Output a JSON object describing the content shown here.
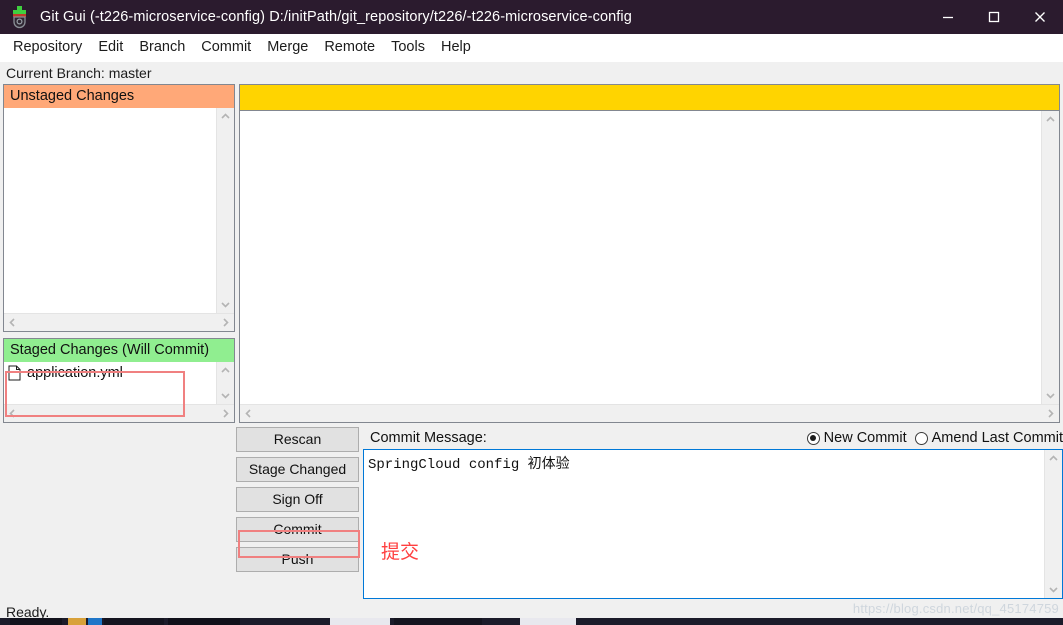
{
  "window": {
    "title": "Git Gui (-t226-microservice-config) D:/initPath/git_repository/t226/-t226-microservice-config",
    "app_icon": "git-gui-icon",
    "controls": {
      "minimize": "minimize-icon",
      "maximize": "maximize-icon",
      "close": "close-icon"
    }
  },
  "menubar": {
    "items": [
      {
        "label": "Repository"
      },
      {
        "label": "Edit"
      },
      {
        "label": "Branch"
      },
      {
        "label": "Commit"
      },
      {
        "label": "Merge"
      },
      {
        "label": "Remote"
      },
      {
        "label": "Tools"
      },
      {
        "label": "Help"
      }
    ]
  },
  "branch": {
    "text": "Current Branch: master"
  },
  "panes": {
    "unstaged": {
      "header": "Unstaged Changes",
      "header_color": "#ffa878",
      "files": []
    },
    "staged": {
      "header": "Staged Changes (Will Commit)",
      "header_color": "#90ee90",
      "files": [
        {
          "name": "application.yml",
          "icon": "file-icon"
        }
      ]
    },
    "diff": {
      "header_strip_color": "#ffd400",
      "content": ""
    }
  },
  "buttons": {
    "rescan": "Rescan",
    "stage_changed": "Stage Changed",
    "sign_off": "Sign Off",
    "commit": "Commit",
    "push": "Push"
  },
  "commit": {
    "label": "Commit Message:",
    "message": "SpringCloud config 初体验",
    "options": [
      {
        "label": "New Commit",
        "selected": true
      },
      {
        "label": "Amend Last Commit",
        "selected": false
      }
    ],
    "new_commit_label": "New Commit",
    "amend_label": "Amend Last Commit"
  },
  "status": {
    "text": "Ready.",
    "watermark": "https://blog.csdn.net/qq_45174759"
  },
  "annotations": {
    "commit_text": "提交",
    "box_color": "#f08080",
    "text_color": "#ff4040"
  },
  "scrollbars": {
    "up": "chevron-up-icon",
    "down": "chevron-down-icon",
    "left": "chevron-left-icon",
    "right": "chevron-right-icon"
  }
}
